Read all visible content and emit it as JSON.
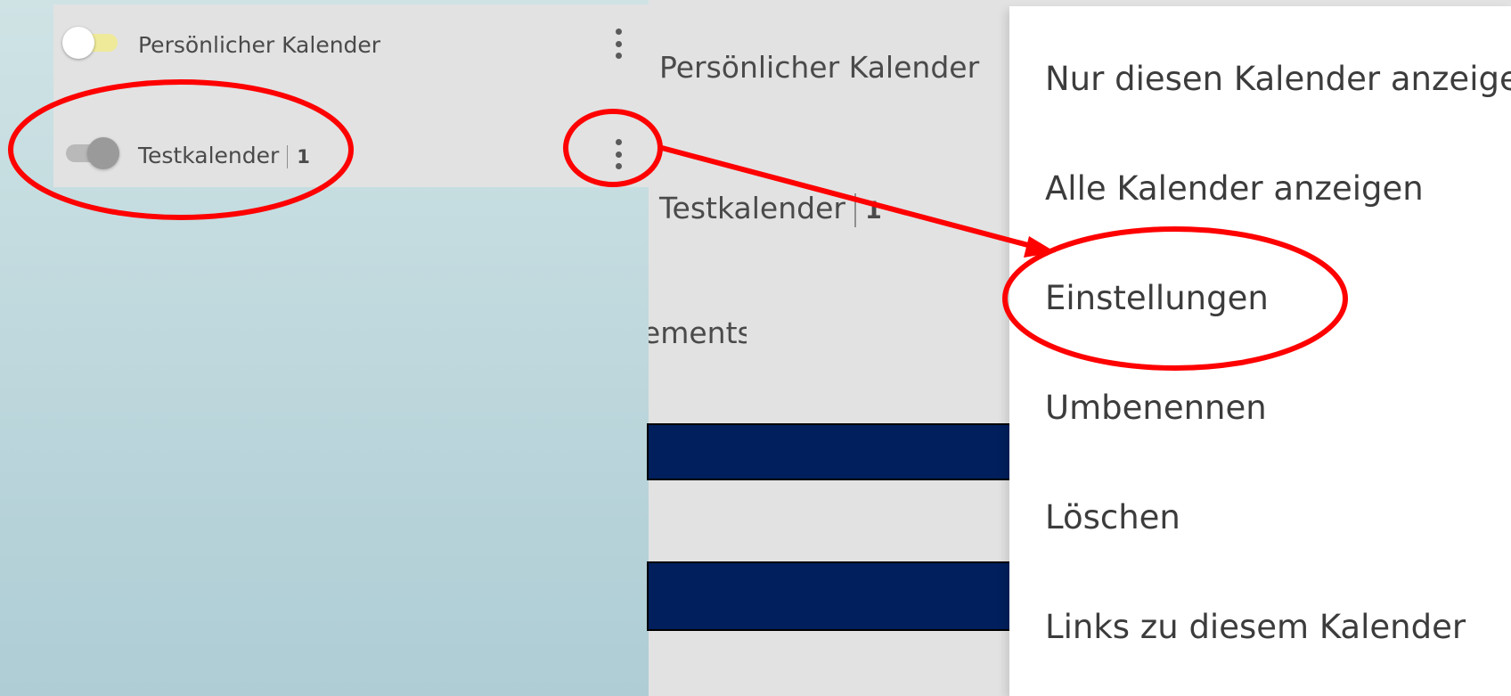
{
  "sidebar": {
    "calendars": [
      {
        "name": "Persönlicher Kalender",
        "count": "",
        "enabled": false,
        "toggle_color": "#eeea9a"
      },
      {
        "name": "Testkalender",
        "count": "1",
        "enabled": true,
        "toggle_color": "#9a9a9a"
      }
    ],
    "more_icon": "more-vertical-icon"
  },
  "background": {
    "calendar_1": "Persönlicher Kalender",
    "calendar_2": "Testkalender",
    "calendar_2_count": "1",
    "partial_heading": "nements",
    "accent_bar_color": "#001f5c"
  },
  "context_menu": {
    "items": [
      "Nur diesen Kalender anzeigen",
      "Alle Kalender anzeigen",
      "Einstellungen",
      "Umbenennen",
      "Löschen",
      "Links zu diesem Kalender"
    ],
    "highlighted_item": "Einstellungen"
  },
  "annotation": {
    "color": "#ff0000"
  }
}
